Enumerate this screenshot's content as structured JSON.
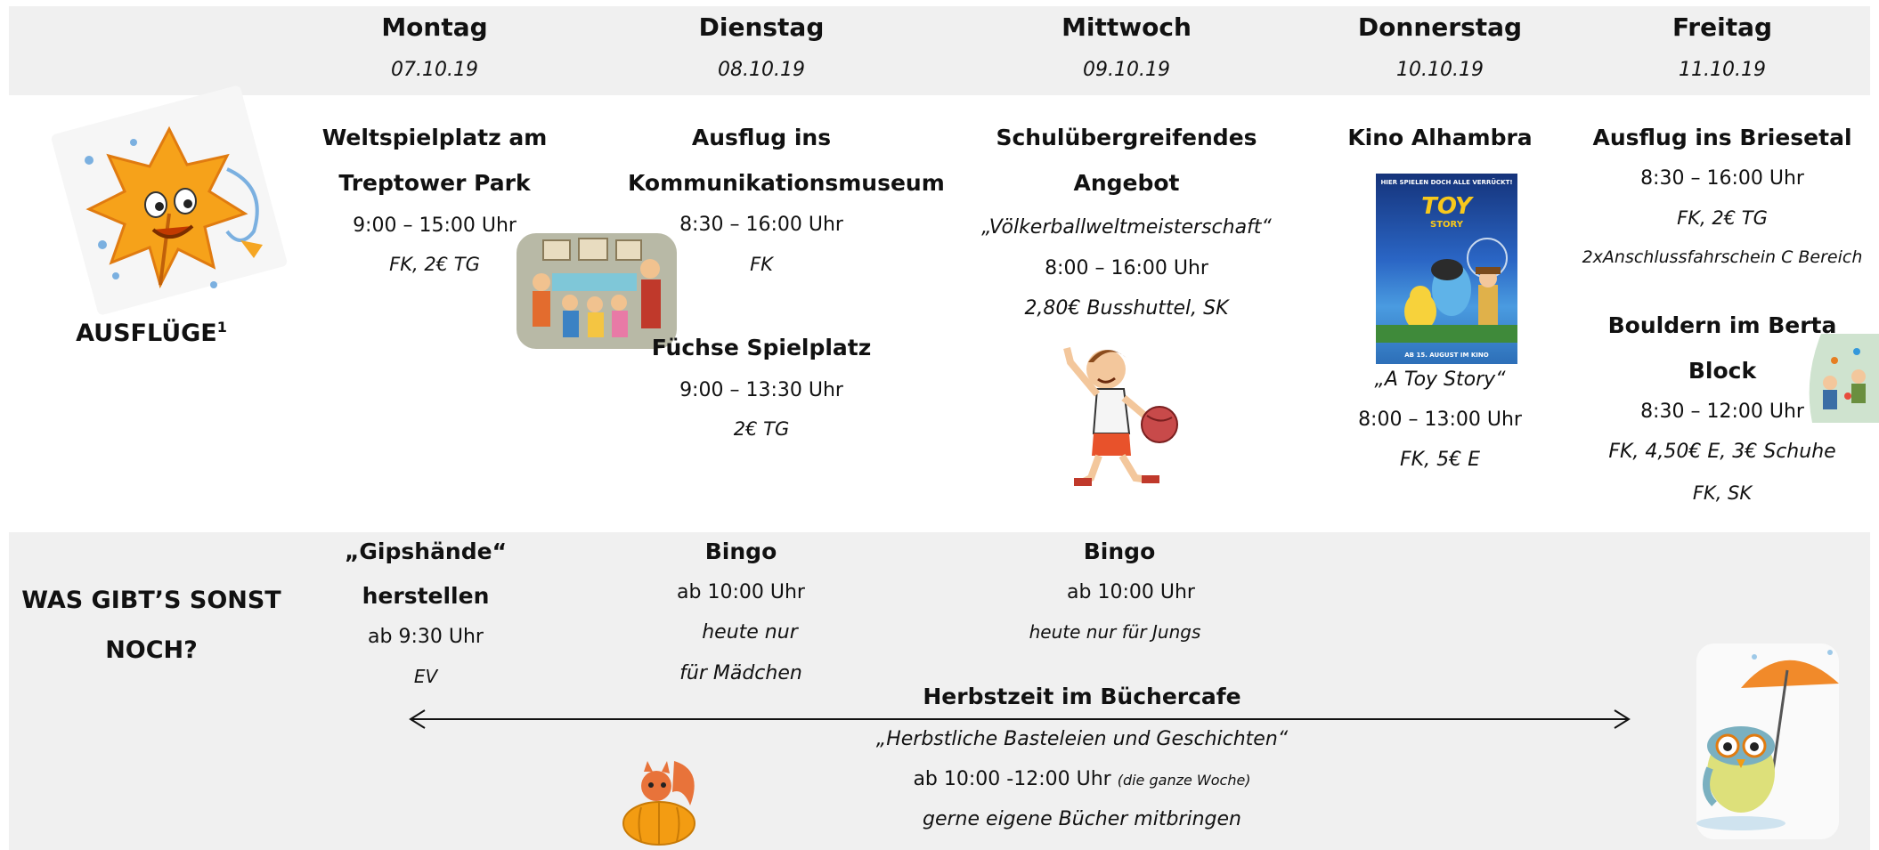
{
  "days": [
    {
      "name": "Montag",
      "date": "07.10.19"
    },
    {
      "name": "Dienstag",
      "date": "08.10.19"
    },
    {
      "name": "Mittwoch",
      "date": "09.10.19"
    },
    {
      "name": "Donnerstag",
      "date": "10.10.19"
    },
    {
      "name": "Freitag",
      "date": "11.10.19"
    }
  ],
  "rows": {
    "excursions_label": "AUSFLÜGE",
    "excursions_footnote": "1",
    "other_label_1": "WAS GIBT’S SONST",
    "other_label_2": "NOCH?"
  },
  "monday": {
    "title_1": "Weltspielplatz am",
    "title_2": "Treptower Park",
    "time": "9:00 – 15:00 Uhr",
    "info": "FK, 2€ TG"
  },
  "tuesday": {
    "title_1": "Ausflug ins",
    "title_2": "Kommunikationsmuseum",
    "time": "8:30 – 16:00 Uhr",
    "info": "FK",
    "second_title": "Füchse Spielplatz",
    "second_time": "9:00 – 13:30 Uhr",
    "second_info": "2€ TG"
  },
  "wednesday": {
    "title_1": "Schulübergreifendes",
    "title_2": "Angebot",
    "subtitle": "„Völkerballweltmeisterschaft“",
    "time": "8:00 – 16:00 Uhr",
    "info": "2,80€ Busshuttel, SK"
  },
  "thursday": {
    "title": "Kino Alhambra",
    "poster_top": "HIER SPIELEN DOCH ALLE VERRÜCKT!",
    "poster_title_1": "TOY",
    "poster_title_2": "STORY",
    "poster_bottom": "AB 15. AUGUST IM KINO",
    "film": "„A Toy Story“",
    "time": "8:00 – 13:00 Uhr",
    "info": "FK, 5€ E"
  },
  "friday": {
    "title": "Ausflug ins Briesetal",
    "time": "8:30 – 16:00 Uhr",
    "info": "FK, 2€ TG",
    "info_2": "2xAnschlussfahrschein C Bereich",
    "second_title_1": "Bouldern im Berta",
    "second_title_2": "Block",
    "second_time": "8:30 – 12:00 Uhr",
    "second_info": "FK, 4,50€ E, 3€ Schuhe",
    "second_info_2": "FK, SK"
  },
  "other": {
    "mon_title_1": "„Gipshände“",
    "mon_title_2": "herstellen",
    "mon_time": "ab 9:30 Uhr",
    "mon_info": "EV",
    "tue_title": "Bingo",
    "tue_time": "ab 10:00 Uhr",
    "tue_info_1": "heute nur",
    "tue_info_2": "für Mädchen",
    "wed_title": "Bingo",
    "wed_time": "ab 10:00 Uhr",
    "wed_info": "heute nur für Jungs",
    "week_title": "Herbstzeit im Büchercafe",
    "week_subtitle": "„Herbstliche Basteleien und Geschichten“",
    "week_time": "ab 10:00 -12:00 Uhr",
    "week_note": "(die ganze Woche)",
    "week_info": "gerne eigene Bücher mitbringen"
  }
}
